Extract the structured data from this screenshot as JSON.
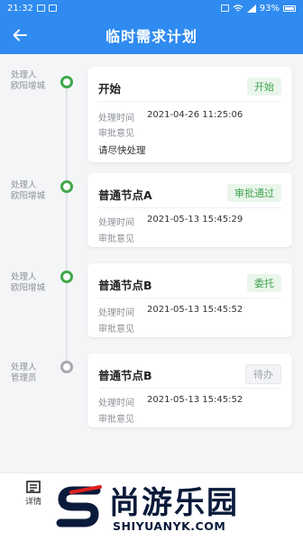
{
  "status_bar": {
    "time": "21:32",
    "battery": "93%"
  },
  "header": {
    "title": "临时需求计划"
  },
  "labels": {
    "time_label": "处理时间",
    "opinion_label": "审批意见",
    "handler_label": "处理人"
  },
  "entries": [
    {
      "handler": "欧阳增城",
      "node": "开始",
      "status": "开始",
      "status_color": "green",
      "time": "2021-04-26 11:25:06",
      "comment": "请尽快处理"
    },
    {
      "handler": "欧阳增城",
      "node": "普通节点A",
      "status": "审批通过",
      "status_color": "green",
      "time": "2021-05-13 15:45:29",
      "comment": ""
    },
    {
      "handler": "欧阳增城",
      "node": "普通节点B",
      "status": "委托",
      "status_color": "green",
      "time": "2021-05-13 15:45:52",
      "comment": ""
    },
    {
      "handler": "管理员",
      "node": "普通节点B",
      "status": "待办",
      "status_color": "gray",
      "time": "2021-05-13 15:45:52",
      "comment": ""
    }
  ],
  "bottom_bar": {
    "detail_label": "详情"
  },
  "watermark": {
    "brand_cn": "尚游乐园",
    "brand_en": "SHIYUANYK.COM"
  },
  "colors": {
    "primary": "#2f8bf0",
    "success": "#41a84b",
    "pending": "#a7a9ad"
  }
}
